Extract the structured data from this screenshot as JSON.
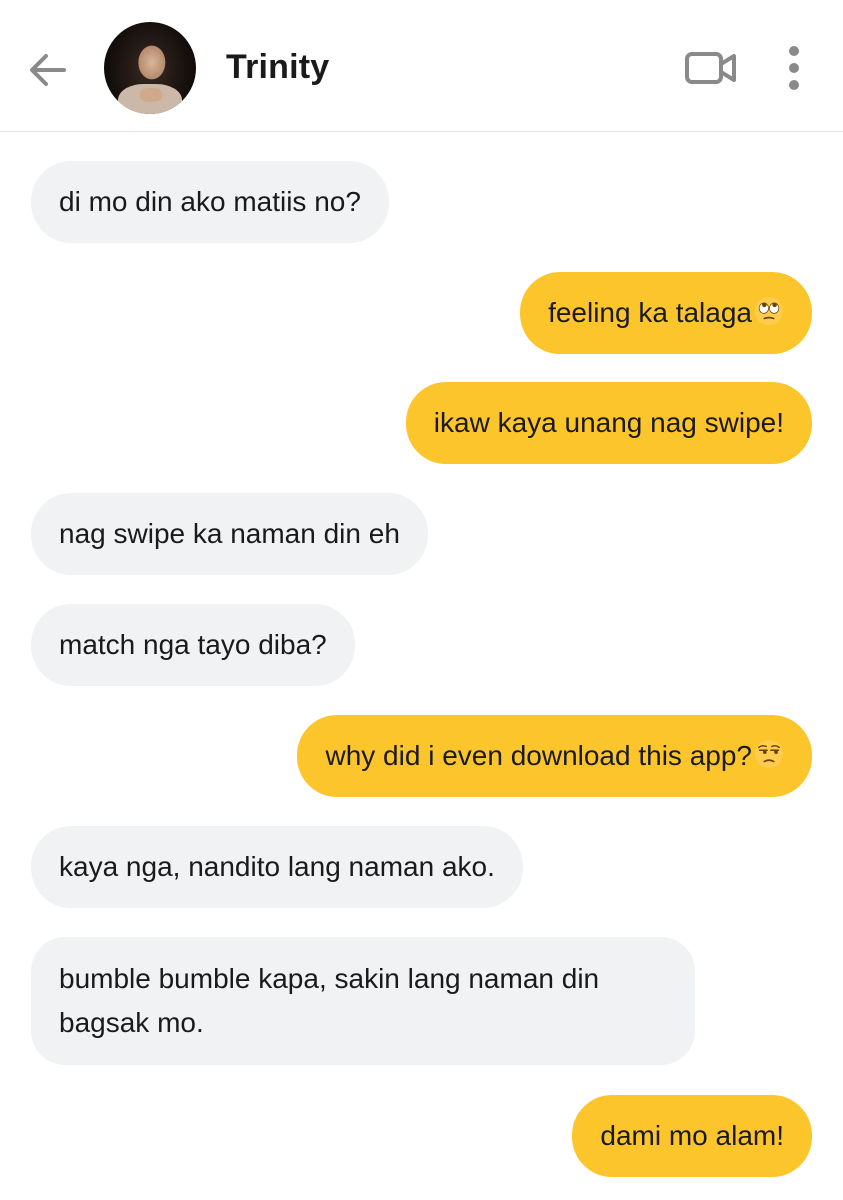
{
  "header": {
    "contact_name": "Trinity",
    "icons": {
      "back": "arrow-left-icon",
      "video": "video-camera-icon",
      "more": "more-vertical-icon"
    }
  },
  "messages": [
    {
      "side": "received",
      "text": "di mo din ako matiis no?"
    },
    {
      "side": "sent",
      "text": "feeling ka talaga",
      "emoji": "face-with-rolling-eyes"
    },
    {
      "side": "sent",
      "text": "ikaw kaya unang nag swipe!"
    },
    {
      "side": "received",
      "text": "nag swipe ka naman din eh"
    },
    {
      "side": "received",
      "text": "match nga tayo diba?"
    },
    {
      "side": "sent",
      "text": "why did i even download this app?",
      "emoji": "unamused-face"
    },
    {
      "side": "received",
      "text": "kaya nga, nandito lang naman ako."
    },
    {
      "side": "received",
      "text": "bumble bumble kapa, sakin lang naman din bagsak mo."
    },
    {
      "side": "sent",
      "text": "dami mo alam!"
    }
  ],
  "colors": {
    "sent_bubble": "#fdc52c",
    "received_bubble": "#f1f2f4",
    "icon_gray": "#8a8a8a"
  }
}
